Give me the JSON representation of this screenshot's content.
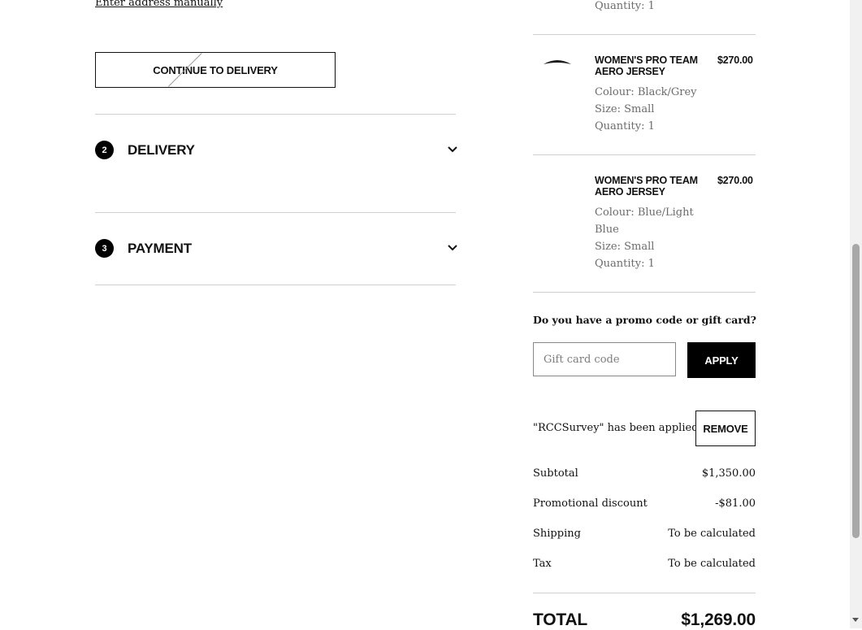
{
  "left": {
    "manual_link": "Enter address manually",
    "continue_button": "CONTINUE TO DELIVERY",
    "steps": [
      {
        "number": "2",
        "label": "DELIVERY",
        "icon": "chevron-down-icon"
      },
      {
        "number": "3",
        "label": "PAYMENT",
        "icon": "chevron-down-icon"
      }
    ]
  },
  "order": {
    "top_quantity": "Quantity: 1",
    "items": [
      {
        "title": "WOMEN'S PRO TEAM AERO JERSEY",
        "price": "$270.00",
        "colour": "Colour: Black/Grey",
        "size": "Size: Small",
        "quantity": "Quantity: 1"
      },
      {
        "title": "WOMEN'S PRO TEAM AERO JERSEY",
        "price": "$270.00",
        "colour": "Colour: Blue/Light Blue",
        "size": "Size: Small",
        "quantity": "Quantity: 1"
      }
    ]
  },
  "promo": {
    "question": "Do you have a promo code or gift card?",
    "placeholder": "Gift card code",
    "apply_label": "APPLY",
    "applied_text": "\"RCCSurvey\" has been applied",
    "remove_label": "REMOVE"
  },
  "summary": {
    "subtotal_label": "Subtotal",
    "subtotal_value": "$1,350.00",
    "discount_label": "Promotional discount",
    "discount_value": "-$81.00",
    "shipping_label": "Shipping",
    "shipping_value": "To be calculated",
    "tax_label": "Tax",
    "tax_value": "To be calculated",
    "total_label": "TOTAL",
    "total_value": "$1,269.00"
  }
}
